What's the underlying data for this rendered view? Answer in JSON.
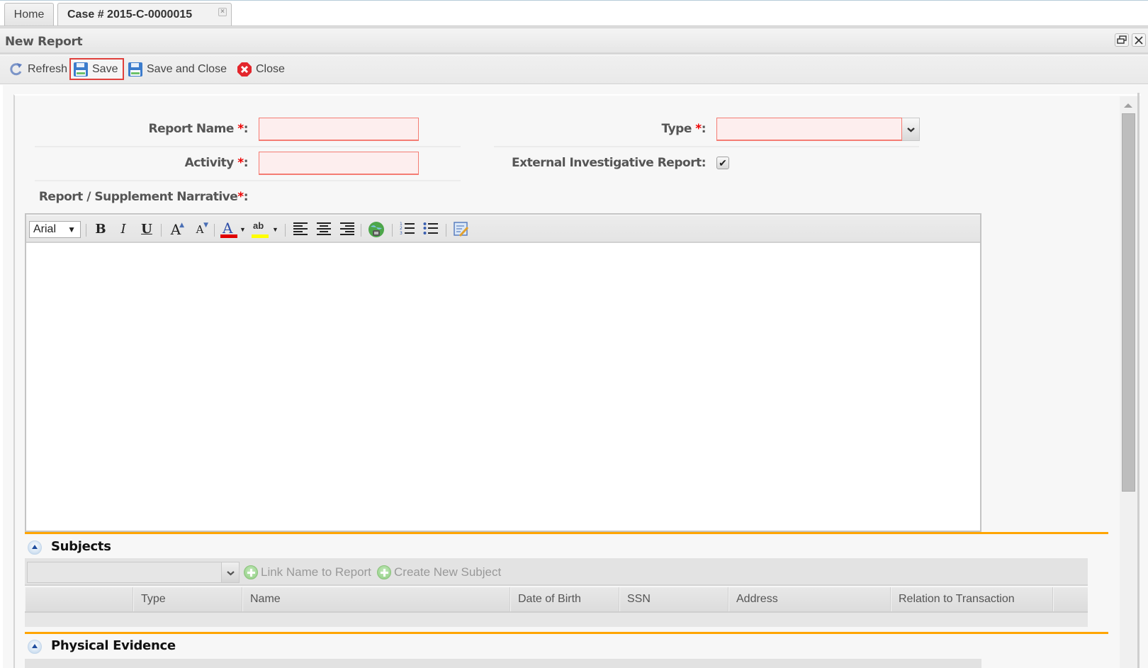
{
  "tabs": [
    {
      "label": "Home",
      "active": false
    },
    {
      "label": "Case # 2015-C-0000015",
      "active": true,
      "closable": true
    }
  ],
  "panel": {
    "title": "New Report",
    "restore_icon": "restore-window-icon",
    "close_icon": "close-icon"
  },
  "toolbar": {
    "refresh_label": "Refresh",
    "save_label": "Save",
    "save_close_label": "Save and Close",
    "close_label": "Close"
  },
  "form": {
    "report_name": {
      "label": "Report Name",
      "required_mark": "*",
      "suffix": ":",
      "value": ""
    },
    "activity": {
      "label": "Activity",
      "required_mark": "*",
      "suffix": ":",
      "value": ""
    },
    "type": {
      "label": "Type",
      "required_mark": "*",
      "suffix": ":",
      "value": ""
    },
    "external_report": {
      "label": "External Investigative Report:",
      "checked": true,
      "check_glyph": "✔"
    },
    "narrative": {
      "label": "Report / Supplement Narrative",
      "required_mark": "*",
      "suffix": ":",
      "value": ""
    }
  },
  "editor": {
    "font": "Arial",
    "font_arrow": "▼",
    "buttons": [
      {
        "name": "bold",
        "glyph": "B"
      },
      {
        "name": "italic",
        "glyph": "I"
      },
      {
        "name": "underline",
        "glyph": "U"
      },
      {
        "name": "increase-font",
        "glyph": "A"
      },
      {
        "name": "decrease-font",
        "glyph": "A"
      },
      {
        "name": "font-color",
        "glyph": "A"
      },
      {
        "name": "highlight",
        "glyph": "ab"
      },
      {
        "name": "align-left",
        "glyph": "≡"
      },
      {
        "name": "align-center",
        "glyph": "≡"
      },
      {
        "name": "align-right",
        "glyph": "≡"
      },
      {
        "name": "link",
        "glyph": ""
      },
      {
        "name": "ordered-list",
        "glyph": ""
      },
      {
        "name": "unordered-list",
        "glyph": ""
      },
      {
        "name": "source-edit",
        "glyph": ""
      }
    ],
    "colors": {
      "font_color": "#e00000",
      "highlight": "#ffff00"
    }
  },
  "subjects": {
    "title": "Subjects",
    "combo_value": "",
    "link_label": "Link Name to Report",
    "create_label": "Create New Subject",
    "columns": [
      "",
      "Type",
      "Name",
      "Date of Birth",
      "SSN",
      "Address",
      "Relation to Transaction",
      ""
    ],
    "rows": []
  },
  "physical_evidence": {
    "title": "Physical Evidence"
  },
  "colors": {
    "accent_orange": "#ffa500",
    "required_red": "#e00000",
    "invalid_bg": "#fdeeee",
    "invalid_border": "#f47c73",
    "save_highlight": "#e0403c"
  }
}
